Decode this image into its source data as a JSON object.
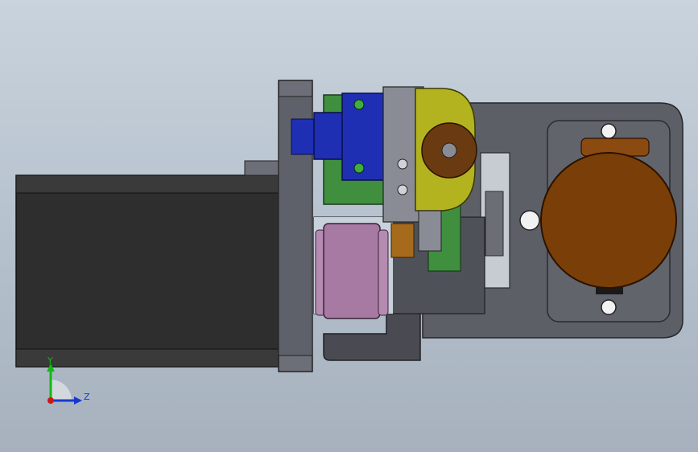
{
  "viewport": {
    "background_top": "#c9d3dd",
    "background_bottom": "#a6b1bd"
  },
  "colors": {
    "motor_body": "#2e2e2e",
    "plate": "#5d5f67",
    "flange": "#6d6f78",
    "sensor_blue": "#1f2fb3",
    "pcb_green": "#3f8f3f",
    "cam_yellow": "#b3b320",
    "wheel_brown": "#6a3a10",
    "spool_pink": "#a77aa3",
    "reel_orange": "#7a3f08",
    "bracket_dark": "#4a4b52"
  },
  "triad": {
    "y_label": "Y",
    "z_label": "Z",
    "y_color": "#14b814",
    "z_color": "#1638d0",
    "origin_color": "#c81818"
  }
}
